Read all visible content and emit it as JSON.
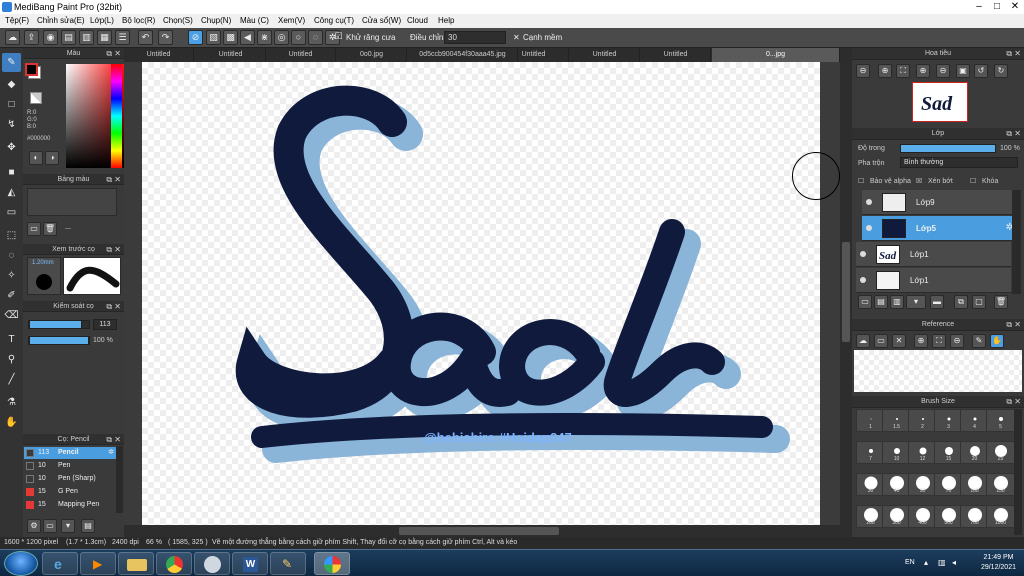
{
  "window": {
    "title": "MediBang Paint Pro (32bit)"
  },
  "menu": [
    "Tệp(F)",
    "Chỉnh sửa(E)",
    "Lớp(L)",
    "Bộ lọc(R)",
    "Chọn(S)",
    "Chụp(N)",
    "Màu (C)",
    "Xem(V)",
    "Công cụ(T)",
    "Cửa sổ(W)",
    "Cloud",
    "Help"
  ],
  "toolbar": {
    "antialias_label": "Khử răng cưa",
    "adjust_label": "Điều chỉnh",
    "adjust_value": "30",
    "soft_edge_label": "Cạnh mềm"
  },
  "tabs": [
    "Untitled",
    "Untitled",
    "Untitled",
    "0o0.jpg",
    "0d5ccb900454f30aaa45.jpg",
    "Untitled",
    "Untitled",
    "Untitled",
    "0...jpg"
  ],
  "color_panel": {
    "title": "Màu",
    "r": "R:0",
    "g": "G:0",
    "b": "B:0",
    "hex": "#000000",
    "fg": "#000000",
    "bg": "#ffffff"
  },
  "palette_panel": {
    "title": "Bảng màu",
    "dashes": "---"
  },
  "brush_preview": {
    "title": "Xem trước cọ",
    "size": "1.20mm"
  },
  "brush_control": {
    "title": "Kiểm soát cọ",
    "size_value": "113",
    "opacity_value": "100 %",
    "size_fraction": 0.88,
    "opacity_fraction": 1.0
  },
  "brush_list": {
    "title": "Cọ: Pencil",
    "items": [
      {
        "size": "113",
        "name": "Pencil",
        "color": "#3a3a3a",
        "selected": true
      },
      {
        "size": "10",
        "name": "Pen",
        "color": "#3a3a3a",
        "selected": false
      },
      {
        "size": "10",
        "name": "Pen (Sharp)",
        "color": "#3a3a3a",
        "selected": false
      },
      {
        "size": "15",
        "name": "G Pen",
        "color": "#e53935",
        "selected": false
      },
      {
        "size": "15",
        "name": "Mapping Pen",
        "color": "#e53935",
        "selected": false
      }
    ]
  },
  "artwork": {
    "main_text": "Sad",
    "credit": "@hebishiro  #Hoidap247",
    "stroke_color": "#0f1a3c",
    "shadow_color": "#8ab4d8"
  },
  "navigator": {
    "title": "Hoa tiêu"
  },
  "layer_panel": {
    "title": "Lớp",
    "opacity_label": "Độ trong",
    "opacity_value": "100 %",
    "blend_label": "Pha trộn",
    "blend_value": "Bình thường",
    "protect_alpha": "Bảo vệ alpha",
    "clipping": "Xén bớt",
    "lock": "Khóa",
    "layers": [
      {
        "name": "Lớp9",
        "selected": false
      },
      {
        "name": "Lớp5",
        "selected": true
      },
      {
        "name": "Lớp1",
        "selected": false
      },
      {
        "name": "Lớp1",
        "selected": false
      }
    ]
  },
  "reference": {
    "title": "Reference"
  },
  "brush_size": {
    "title": "Brush Size",
    "sizes": [
      "1",
      "1.5",
      "2",
      "3",
      "4",
      "5",
      "7",
      "10",
      "12",
      "15",
      "20",
      "25",
      "30",
      "40",
      "50",
      "70",
      "100",
      "150",
      "200",
      "300",
      "400",
      "500",
      "700",
      "1000"
    ]
  },
  "status": {
    "dimensions": "1600 * 1200 pixel",
    "cm": "(1.7 * 1.3cm)",
    "dpi": "2400 dpi",
    "zoom": "66 %",
    "coords": "( 1585, 325 )",
    "hint": "Vẽ một đường thẳng bằng cách giữ phím Shift, Thay đổi cỡ cọ bằng cách giữ phím Ctrl, Alt và kéo"
  },
  "taskbar": {
    "lang": "EN",
    "time": "21:49 PM",
    "date": "29/12/2021"
  }
}
